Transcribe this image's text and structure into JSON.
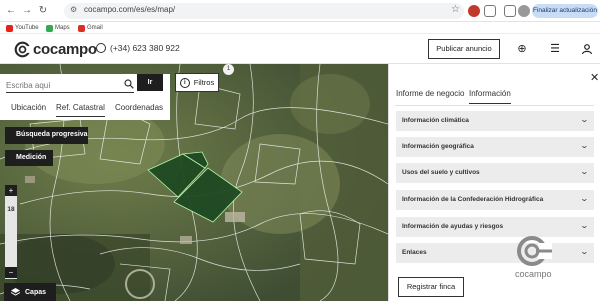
{
  "browser": {
    "url": "cocampo.com/es/es/map/",
    "update_button": "Finalizar actualización",
    "bookmarks": [
      {
        "label": "YouTube",
        "color": "#e62117"
      },
      {
        "label": "Maps",
        "color": "#34a853"
      },
      {
        "label": "Gmail",
        "color": "#d93025"
      }
    ]
  },
  "header": {
    "logo_text": "cocampo",
    "phone": "(+34) 623 380 922",
    "publish_button": "Publicar anuncio"
  },
  "search": {
    "placeholder": "Escriba aquí",
    "go_button": "Ir",
    "tabs": [
      "Ubicación",
      "Ref. Catastral",
      "Coordenadas"
    ],
    "active_tab": "Ref. Catastral"
  },
  "map_controls": {
    "filters_label": "Filtros",
    "filters_count": "1",
    "progressive_search": "Búsqueda progresiva",
    "measurement": "Medición",
    "zoom_in": "+",
    "zoom_out": "−",
    "zoom_level": "18",
    "layers": "Capas"
  },
  "panel": {
    "tabs": [
      "Informe de negocio",
      "Información"
    ],
    "active_tab": "Información",
    "sections": [
      "Información climática",
      "Información geográfica",
      "Usos del suelo y cultivos",
      "Información de la Confederación Hidrográfica",
      "Información de ayudas y riesgos",
      "Enlaces"
    ],
    "register_button": "Registrar finca",
    "watermark": "cocampo"
  },
  "colors": {
    "accent_dark": "#1e1e1e",
    "parcel_highlight": "#1f4a23",
    "accordion_bg": "#ececec"
  }
}
